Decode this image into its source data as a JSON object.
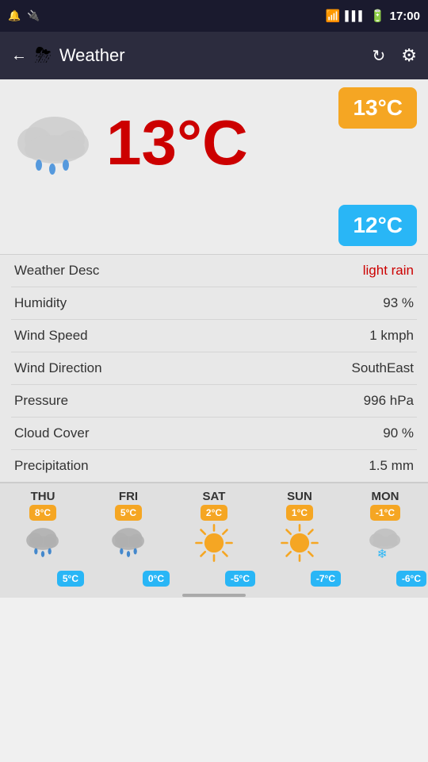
{
  "status_bar": {
    "time": "17:00",
    "icons": [
      "notification",
      "usb",
      "wifi",
      "signal1",
      "signal2",
      "battery"
    ]
  },
  "app_bar": {
    "title": "Weather",
    "back_label": "←",
    "refresh_label": "↻",
    "settings_label": "⚙"
  },
  "current_weather": {
    "temp_main": "13°C",
    "temp_hi_badge": "13°C",
    "temp_lo_badge": "12°C"
  },
  "details": [
    {
      "label": "Weather Desc",
      "value": "light rain",
      "red": true
    },
    {
      "label": "Humidity",
      "value": "93 %",
      "red": false
    },
    {
      "label": "Wind Speed",
      "value": "1 kmph",
      "red": false
    },
    {
      "label": "Wind Direction",
      "value": "SouthEast",
      "red": false
    },
    {
      "label": "Pressure",
      "value": "996 hPa",
      "red": false
    },
    {
      "label": "Cloud Cover",
      "value": "90 %",
      "red": false
    },
    {
      "label": "Precipitation",
      "value": "1.5 mm",
      "red": false
    }
  ],
  "forecast": [
    {
      "day": "THU",
      "hi": "8°C",
      "lo": "5°C",
      "type": "rain"
    },
    {
      "day": "FRI",
      "hi": "5°C",
      "lo": "0°C",
      "type": "rain"
    },
    {
      "day": "SAT",
      "hi": "2°C",
      "lo": "-5°C",
      "type": "sun"
    },
    {
      "day": "SUN",
      "hi": "1°C",
      "lo": "-7°C",
      "type": "sun"
    },
    {
      "day": "MON",
      "hi": "-1°C",
      "lo": "-6°C",
      "type": "snow"
    }
  ]
}
